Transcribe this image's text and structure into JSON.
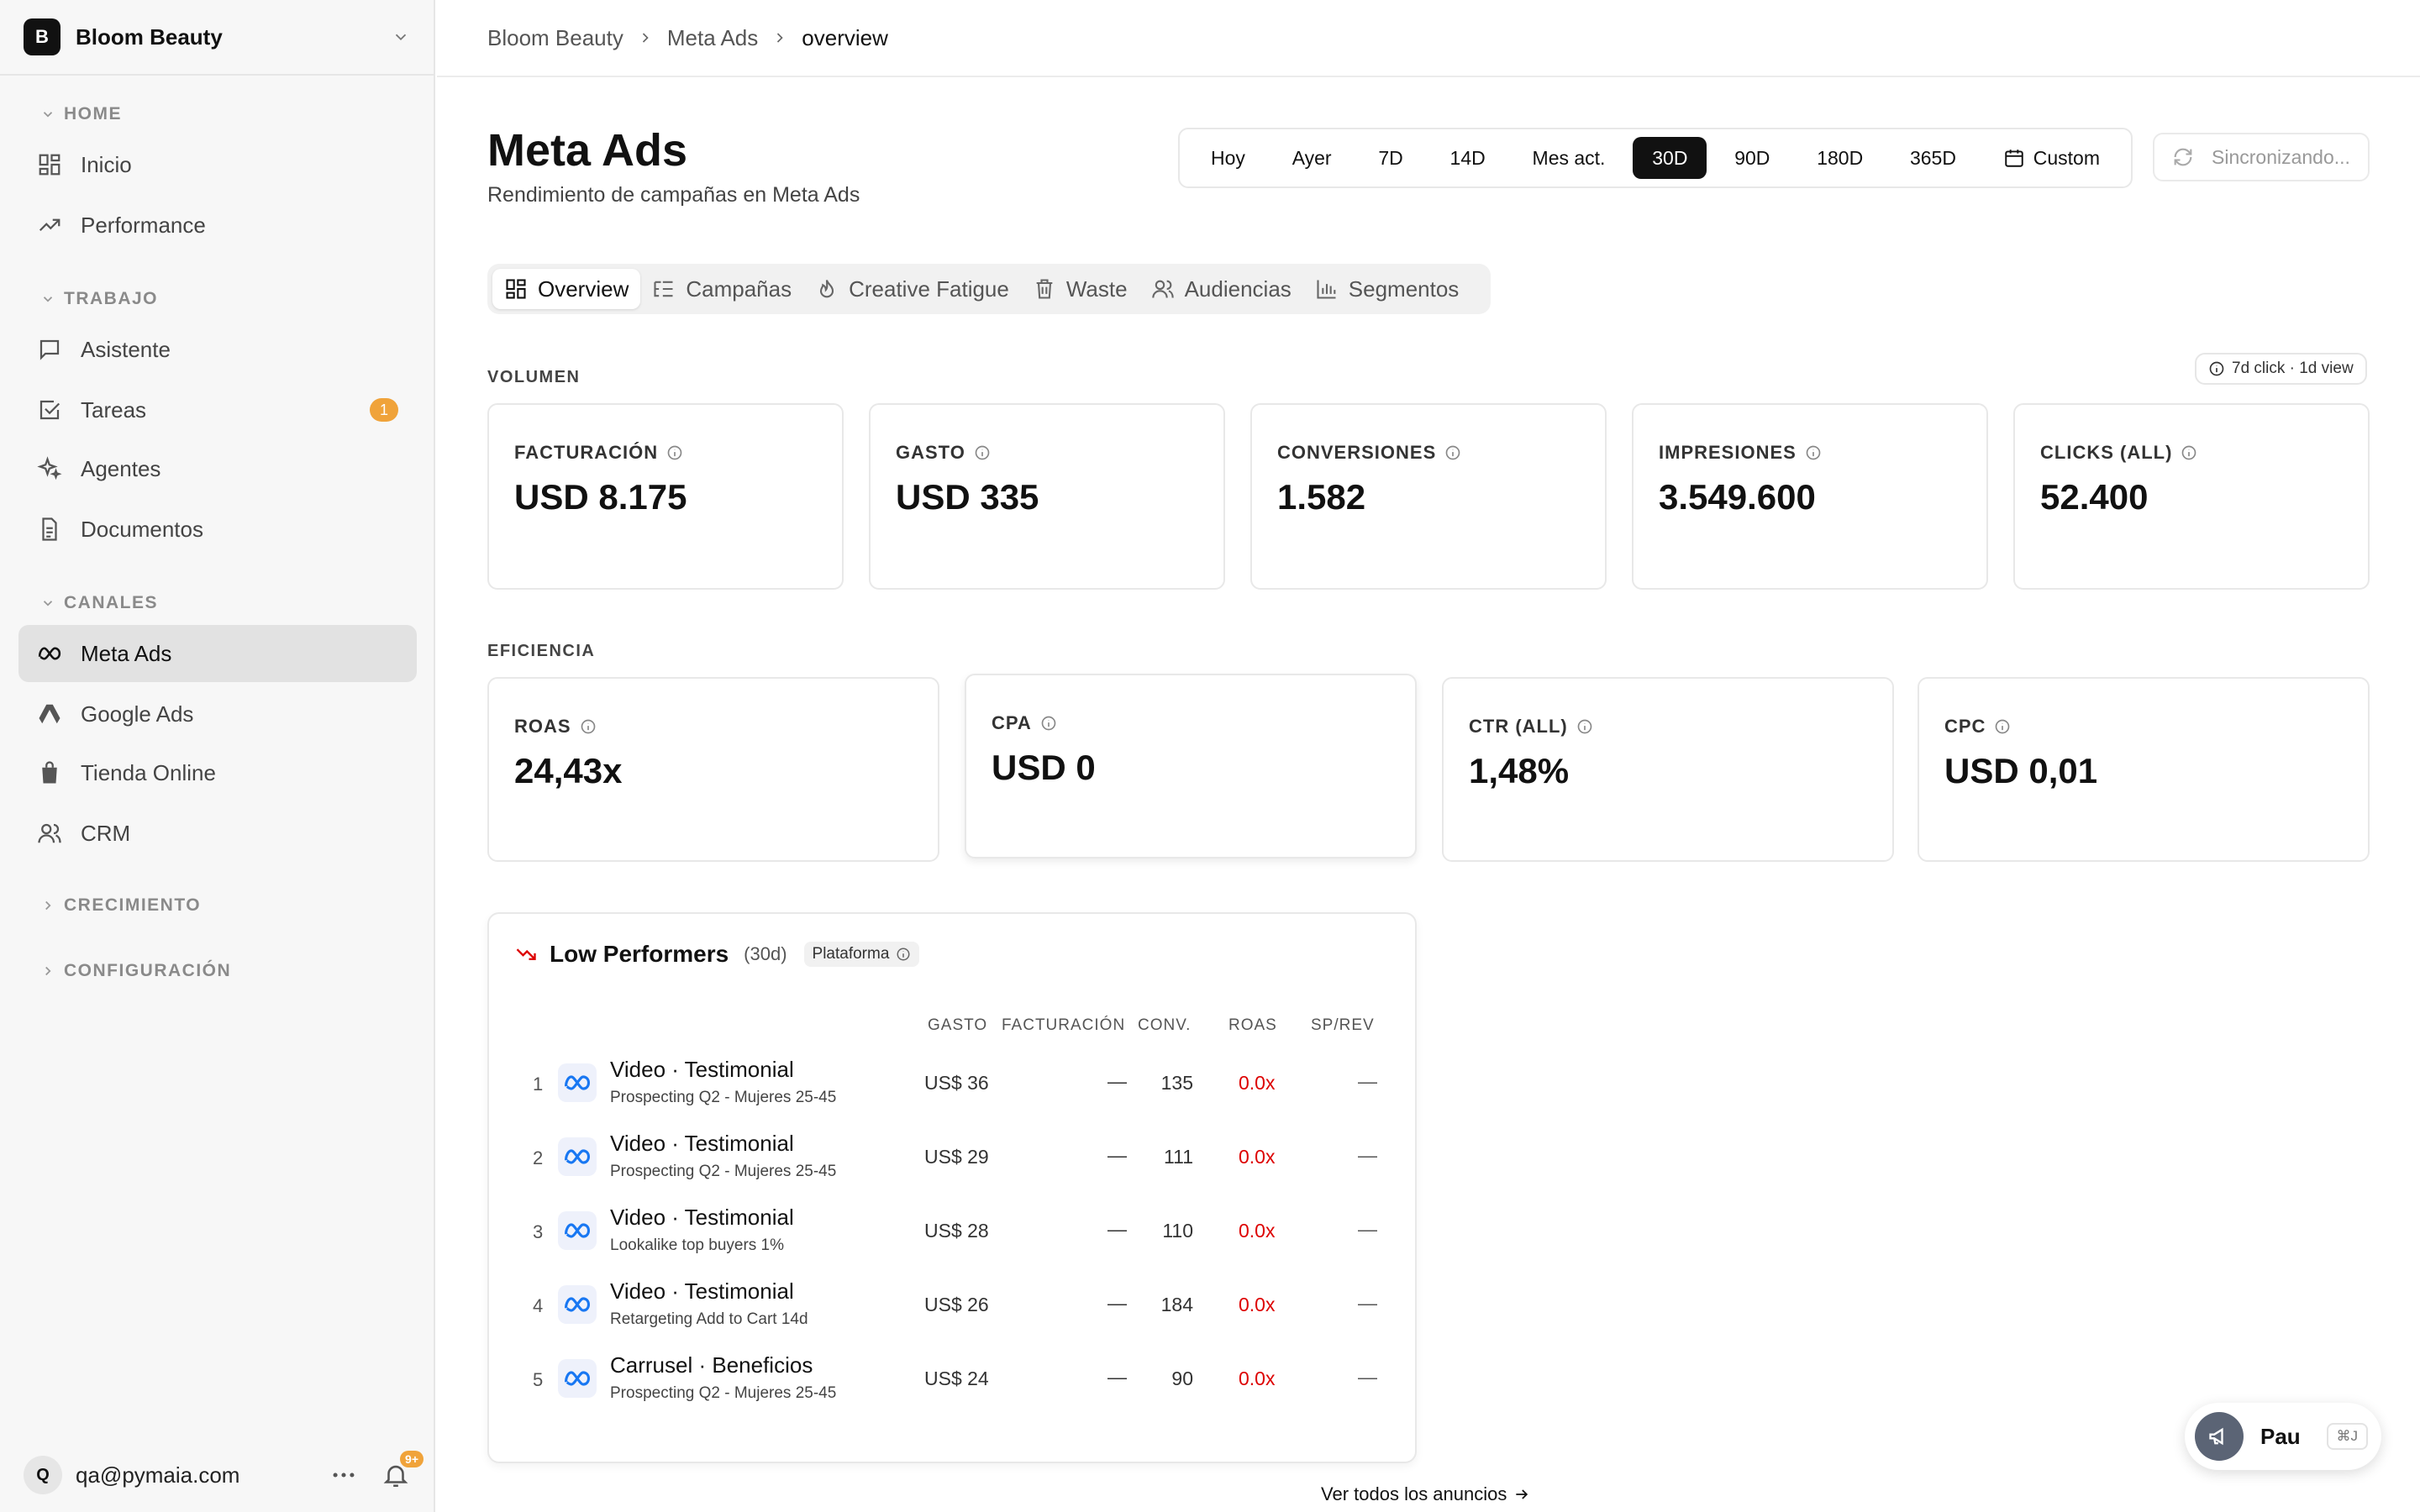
{
  "workspace": {
    "initial": "B",
    "name": "Bloom Beauty"
  },
  "sidebar": {
    "sections": {
      "home": "HOME",
      "trabajo": "TRABAJO",
      "canales": "CANALES",
      "crecimiento": "CRECIMIENTO",
      "configuracion": "CONFIGURACIÓN"
    },
    "items": {
      "inicio": "Inicio",
      "performance": "Performance",
      "asistente": "Asistente",
      "tareas": "Tareas",
      "tareas_badge": "1",
      "agentes": "Agentes",
      "documentos": "Documentos",
      "meta_ads": "Meta Ads",
      "google_ads": "Google Ads",
      "tienda": "Tienda Online",
      "crm": "CRM"
    },
    "user": {
      "initial": "Q",
      "email": "qa@pymaia.com",
      "notifications": "9+"
    }
  },
  "breadcrumb": [
    "Bloom Beauty",
    "Meta Ads",
    "overview"
  ],
  "page": {
    "title": "Meta Ads",
    "subtitle": "Rendimiento de campañas en Meta Ads"
  },
  "ranges": {
    "items": [
      "Hoy",
      "Ayer",
      "7D",
      "14D",
      "Mes act.",
      "30D",
      "90D",
      "180D",
      "365D"
    ],
    "selected": "30D",
    "custom": "Custom"
  },
  "sync_label": "Sincronizando...",
  "tabs": [
    "Overview",
    "Campañas",
    "Creative Fatigue",
    "Waste",
    "Audiencias",
    "Segmentos"
  ],
  "attribution": "7d click · 1d view",
  "volumen": {
    "label": "VOLUMEN",
    "cards": [
      {
        "label": "FACTURACIÓN",
        "value": "USD 8.175"
      },
      {
        "label": "GASTO",
        "value": "USD 335"
      },
      {
        "label": "CONVERSIONES",
        "value": "1.582"
      },
      {
        "label": "IMPRESIONES",
        "value": "3.549.600"
      },
      {
        "label": "CLICKS (ALL)",
        "value": "52.400"
      }
    ]
  },
  "eficiencia": {
    "label": "EFICIENCIA",
    "cards": [
      {
        "label": "ROAS",
        "value": "24,43x"
      },
      {
        "label": "CPA",
        "value": "USD 0"
      },
      {
        "label": "CTR (ALL)",
        "value": "1,48%"
      },
      {
        "label": "CPC",
        "value": "USD 0,01"
      }
    ]
  },
  "low_performers": {
    "title": "Low Performers",
    "period": "(30d)",
    "pill": "Plataforma",
    "headers": [
      "GASTO",
      "FACTURACIÓN",
      "CONV.",
      "ROAS",
      "SP/REV"
    ],
    "rows": [
      {
        "rank": "1",
        "name": "Video · Testimonial",
        "sub": "Prospecting Q2 - Mujeres 25-45",
        "gasto": "US$ 36",
        "fact": "—",
        "conv": "135",
        "roas": "0.0x",
        "sprev": "—"
      },
      {
        "rank": "2",
        "name": "Video · Testimonial",
        "sub": "Prospecting Q2 - Mujeres 25-45",
        "gasto": "US$ 29",
        "fact": "—",
        "conv": "111",
        "roas": "0.0x",
        "sprev": "—"
      },
      {
        "rank": "3",
        "name": "Video · Testimonial",
        "sub": "Lookalike top buyers 1%",
        "gasto": "US$ 28",
        "fact": "—",
        "conv": "110",
        "roas": "0.0x",
        "sprev": "—"
      },
      {
        "rank": "4",
        "name": "Video · Testimonial",
        "sub": "Retargeting Add to Cart 14d",
        "gasto": "US$ 26",
        "fact": "—",
        "conv": "184",
        "roas": "0.0x",
        "sprev": "—"
      },
      {
        "rank": "5",
        "name": "Carrusel · Beneficios",
        "sub": "Prospecting Q2 - Mujeres 25-45",
        "gasto": "US$ 24",
        "fact": "—",
        "conv": "90",
        "roas": "0.0x",
        "sprev": "—"
      }
    ],
    "see_all": "Ver todos los anuncios"
  },
  "assistant": {
    "name": "Pau",
    "shortcut": "⌘J"
  },
  "colors": {
    "accent": "#111111",
    "badge": "#f0a33a",
    "negative": "#dd0000",
    "meta_blue": "#1877f2"
  }
}
